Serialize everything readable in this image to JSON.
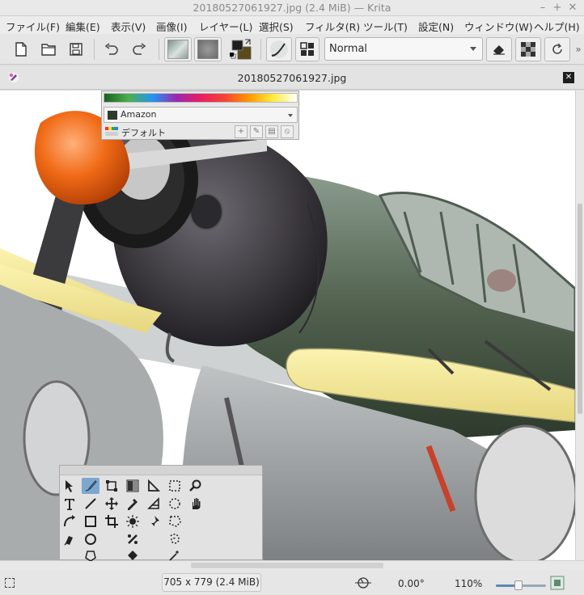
{
  "window": {
    "title": "20180527061927.jpg (2.4 MiB)  — Krita"
  },
  "menu": [
    "ファイル(F)",
    "編集(E)",
    "表示(V)",
    "画像(I)",
    "レイヤー(L)",
    "選択(S)",
    "フィルタ(R)",
    "ツール(T)",
    "設定(N)",
    "ウィンドウ(W)",
    "ヘルプ(H)"
  ],
  "toolbar": {
    "blending_mode": "Normal"
  },
  "document": {
    "tab_name": "20180527061927.jpg"
  },
  "palette": {
    "name": "Amazon",
    "set": "デフォルト"
  },
  "status": {
    "image_size": "705 x 779 (2.4 MiB)",
    "rotation": "0.00°",
    "zoom": "110%",
    "zoom_slider_fraction": 0.45
  },
  "colors": {
    "accent": "#7ea7cf",
    "foreground": "#1e1e1e",
    "background": "#5a4a1a"
  }
}
